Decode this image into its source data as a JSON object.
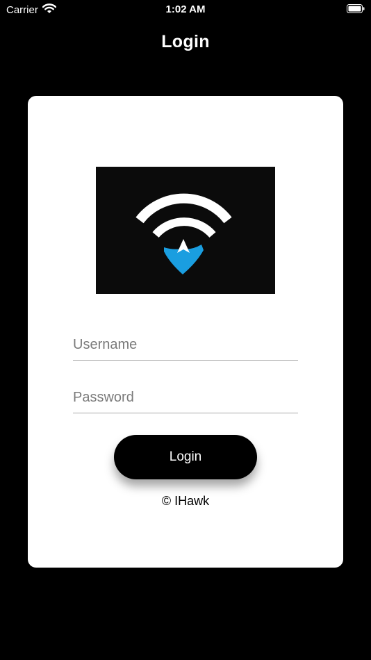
{
  "status_bar": {
    "carrier": "Carrier",
    "time": "1:02 AM",
    "icons": [
      "wifi-icon",
      "battery-icon"
    ]
  },
  "nav": {
    "title": "Login"
  },
  "login_form": {
    "logo_icon": "wifi-location-logo",
    "username_placeholder": "Username",
    "password_placeholder": "Password",
    "username_value": "",
    "password_value": "",
    "login_button_label": "Login",
    "copyright": "© IHawk"
  },
  "colors": {
    "background": "#000000",
    "card": "#ffffff",
    "button": "#000000",
    "logo_accent": "#1a9ee0",
    "logo_background": "#0b0b0b"
  }
}
